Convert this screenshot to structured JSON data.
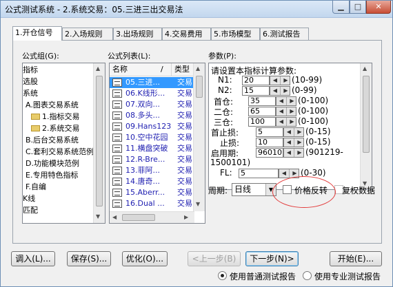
{
  "window": {
    "title": "公式测试系统 - 2.系统交易：05.三进三出交易法",
    "min_icon": "minimize-icon",
    "max_icon": "maximize-icon",
    "close_icon": "close-icon"
  },
  "tabs": [
    "1.开仓信号",
    "2.入场规则",
    "3.出场规则",
    "4.交易费用",
    "5.市场模型",
    "6.测试报告"
  ],
  "formula_group": {
    "label": "公式组(G):",
    "items": [
      "指标",
      "选股",
      "系统",
      "A.图表交易系统",
      "1.指标交易",
      "2.系统交易",
      "B.后台交易系统",
      "C.套利交易系统范例",
      "D.功能模块范例",
      "E.专用特色指标",
      "F.自编",
      "K线",
      "匹配"
    ],
    "selected_index": 5
  },
  "formula_list": {
    "label": "公式列表(L):",
    "col_name": "名称",
    "col_sep": "/",
    "col_type": "类型",
    "rows": [
      {
        "name": "05.三进...",
        "type": "交易"
      },
      {
        "name": "06.K线形...",
        "type": "交易"
      },
      {
        "name": "07.双向...",
        "type": "交易"
      },
      {
        "name": "08.多头...",
        "type": "交易"
      },
      {
        "name": "09.Hans123",
        "type": "交易"
      },
      {
        "name": "10.空中花园",
        "type": "交易"
      },
      {
        "name": "11.横盘突破",
        "type": "交易"
      },
      {
        "name": "12.R-Bre...",
        "type": "交易"
      },
      {
        "name": "13.菲阿...",
        "type": "交易"
      },
      {
        "name": "14.唐奇...",
        "type": "交易"
      },
      {
        "name": "15.Aberr...",
        "type": "交易"
      },
      {
        "name": "16.Dual ...",
        "type": "交易"
      }
    ],
    "selected_index": 0
  },
  "params": {
    "label": "参数(P):",
    "header": "请设置本指标计算参数:",
    "rows": [
      {
        "label": "N1:",
        "value": "20",
        "range": "(10-99)"
      },
      {
        "label": "N2:",
        "value": "15",
        "range": "(0-99)"
      },
      {
        "label": "首仓:",
        "value": "35",
        "range": "(0-100)"
      },
      {
        "label": "二仓:",
        "value": "65",
        "range": "(0-100)"
      },
      {
        "label": "三仓:",
        "value": "100",
        "range": "(0-100)"
      },
      {
        "label": "首止损:",
        "value": "5",
        "range": "(0-15)"
      },
      {
        "label": "止损:",
        "value": "10",
        "range": "(0-15)"
      },
      {
        "label": "启用期:",
        "value": "96010",
        "range": "(901219-"
      },
      {
        "label": "FL:",
        "value": "5",
        "range": "(0-30)"
      }
    ],
    "wrap_text": "1500101)"
  },
  "period": {
    "label": "周期:",
    "value": "日线",
    "reverse_label": "价格反转",
    "reverse_checked": false,
    "adjust_label": "复权数据",
    "adjust_checked": false
  },
  "buttons": {
    "import": "调入(L)...",
    "save": "保存(S)...",
    "optimize": "优化(O)...",
    "prev": "<上一步(B)",
    "next": "下一步(N)>",
    "start": "开始(E)..."
  },
  "report": {
    "normal": "使用普通测试报告",
    "pro": "使用专业测试报告",
    "selected": "normal"
  },
  "colors": {
    "annotation": "#e23a3a",
    "list_text": "#1d1db0",
    "selected_bg": "#3399ff"
  }
}
